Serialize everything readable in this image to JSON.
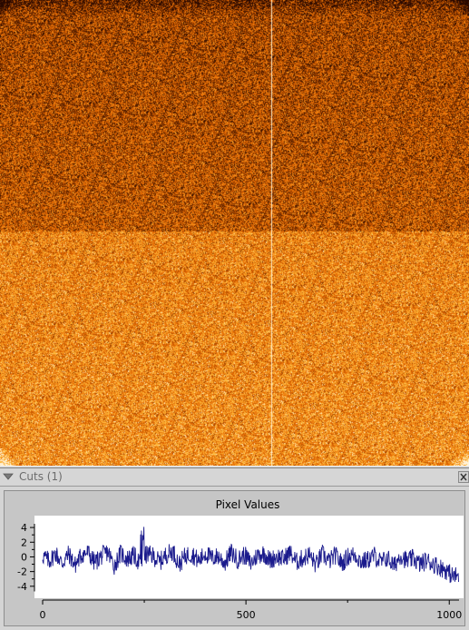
{
  "colors": {
    "image_dark": "#1a0800",
    "image_mid": "#e07a1c",
    "image_light": "#ffe0b8",
    "panel_bg": "#d4d4d4",
    "plot_bg": "#ffffff",
    "series": "#1a1a8c"
  },
  "image": {
    "colormap": "heat",
    "upper_half_level": "darker",
    "lower_half_level": "brighter",
    "has_vertical_bright_column": true
  },
  "cuts_panel": {
    "title": "Cuts (1)",
    "collapse_icon": "chevron-down-icon",
    "close_icon": "close-icon"
  },
  "chart_data": {
    "type": "line",
    "title": "Pixel Values",
    "xlabel": "",
    "ylabel": "",
    "xlim": [
      0,
      1024
    ],
    "ylim": [
      -6,
      5
    ],
    "x_ticks": [
      0,
      500,
      1000
    ],
    "y_ticks": [
      4,
      2,
      0,
      -2,
      -4
    ],
    "series": [
      {
        "x_start": 0,
        "x_step": 16,
        "values": [
          0.2,
          -0.6,
          0.5,
          -0.9,
          0.4,
          -1.1,
          0.3,
          0.6,
          -0.8,
          0.1,
          0.7,
          -1.2,
          0.5,
          -0.3,
          0.2,
          -0.9,
          0.4,
          0.1,
          -0.7,
          0.3,
          0.8,
          -1.0,
          0.2,
          0.4,
          -0.6,
          0.5,
          -0.2,
          0.1,
          -0.8,
          0.6,
          -0.4,
          0.3,
          -0.9,
          0.2,
          0.5,
          -0.5,
          0.1,
          -0.3,
          0.6,
          -0.7,
          -0.2,
          0.3,
          -1.1,
          0.4,
          -0.6,
          0.2,
          -0.9,
          0.1,
          0.3,
          -0.7,
          -0.4,
          0.2,
          -0.8,
          -0.1,
          -1.3,
          0.3,
          -0.6,
          -0.2,
          -1.0,
          -0.5,
          -0.9,
          -1.4,
          -1.8,
          -2.6
        ]
      }
    ]
  }
}
